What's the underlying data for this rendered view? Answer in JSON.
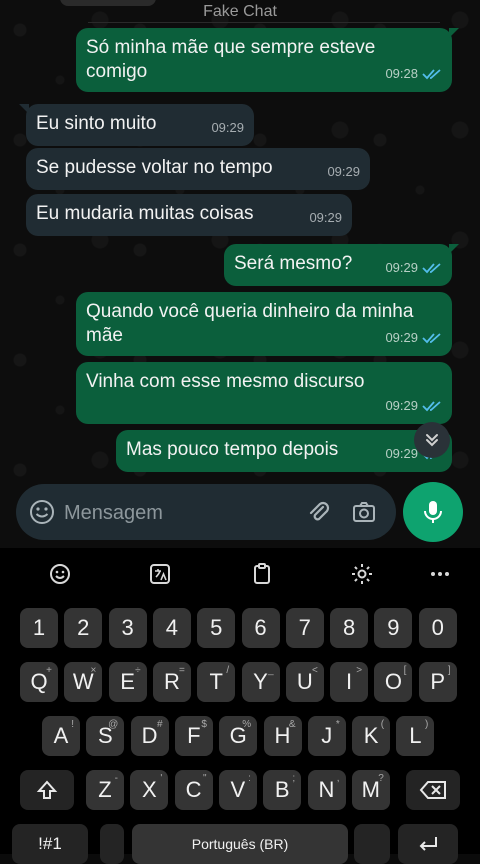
{
  "header": {
    "title": "Fake Chat"
  },
  "messages": [
    {
      "dir": "out",
      "text": "Só minha mãe que sempre esteve comigo",
      "time": "09:28"
    },
    {
      "dir": "in",
      "text": "Eu sinto muito",
      "time": "09:29"
    },
    {
      "dir": "in",
      "text": "Se pudesse voltar no tempo",
      "time": "09:29"
    },
    {
      "dir": "in",
      "text": "Eu mudaria muitas coisas",
      "time": "09:29"
    },
    {
      "dir": "out",
      "text": "Será mesmo?",
      "time": "09:29"
    },
    {
      "dir": "out",
      "text": "Quando você queria dinheiro da minha mãe",
      "time": "09:29"
    },
    {
      "dir": "out",
      "text": "Vinha com esse mesmo discurso",
      "time": "09:29"
    },
    {
      "dir": "out",
      "text": "Mas pouco tempo depois",
      "time": "09:29"
    }
  ],
  "composer": {
    "placeholder": "Mensagem"
  },
  "keyboard": {
    "numbers": [
      "1",
      "2",
      "3",
      "4",
      "5",
      "6",
      "7",
      "8",
      "9",
      "0"
    ],
    "row1": [
      {
        "k": "Q",
        "s": "+"
      },
      {
        "k": "W",
        "s": "×"
      },
      {
        "k": "E",
        "s": "÷"
      },
      {
        "k": "R",
        "s": "="
      },
      {
        "k": "T",
        "s": "/"
      },
      {
        "k": "Y",
        "s": "_"
      },
      {
        "k": "U",
        "s": "<"
      },
      {
        "k": "I",
        "s": ">"
      },
      {
        "k": "O",
        "s": "["
      },
      {
        "k": "P",
        "s": "]"
      }
    ],
    "row2": [
      {
        "k": "A",
        "s": "!"
      },
      {
        "k": "S",
        "s": "@"
      },
      {
        "k": "D",
        "s": "#"
      },
      {
        "k": "F",
        "s": "$"
      },
      {
        "k": "G",
        "s": "%"
      },
      {
        "k": "H",
        "s": "&"
      },
      {
        "k": "J",
        "s": "*"
      },
      {
        "k": "K",
        "s": "("
      },
      {
        "k": "L",
        "s": ")"
      }
    ],
    "row3": [
      {
        "k": "Z",
        "s": "-"
      },
      {
        "k": "X",
        "s": "'"
      },
      {
        "k": "C",
        "s": "\""
      },
      {
        "k": "V",
        "s": ":"
      },
      {
        "k": "B",
        "s": ";"
      },
      {
        "k": "N",
        "s": ","
      },
      {
        "k": "M",
        "s": "?"
      }
    ],
    "symbols_label": "!#1",
    "space_label": "Português (BR)"
  },
  "colors": {
    "outgoing": "#0b5f3c",
    "incoming": "#202c33",
    "accent": "#0ea36f",
    "read_ticks": "#53bdeb"
  }
}
